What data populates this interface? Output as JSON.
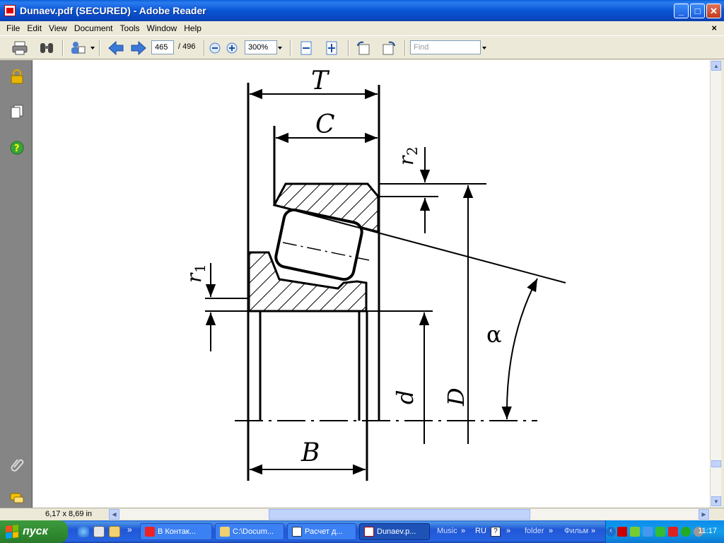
{
  "window": {
    "title": "Dunaev.pdf (SECURED) - Adobe Reader",
    "minimize_label": "_",
    "maximize_label": "□",
    "close_label": "✕"
  },
  "menu": {
    "items": [
      "File",
      "Edit",
      "View",
      "Document",
      "Tools",
      "Window",
      "Help"
    ],
    "doc_close": "×"
  },
  "toolbar": {
    "current_page": "465",
    "total_pages": "/ 496",
    "zoom": "300%",
    "find_placeholder": "Find"
  },
  "drawing": {
    "label_T": "T",
    "label_C": "C",
    "label_B": "B",
    "label_r1": "r",
    "label_r1_sub": "1",
    "label_r2": "r",
    "label_r2_sub": "2",
    "label_d": "d",
    "label_D": "D",
    "label_alpha": "α"
  },
  "status": {
    "page_size": "6,17 x 8,69 in"
  },
  "taskbar": {
    "start_label": "пуск",
    "chevron": "»",
    "tasks": [
      {
        "label": "В Контак..."
      },
      {
        "label": "C:\\Docum..."
      },
      {
        "label": "Расчет д..."
      },
      {
        "label": "Dunaev.p..."
      }
    ],
    "music": "Music",
    "lang": "RU",
    "folder": "folder",
    "film": "Фильм",
    "clock": "11:17"
  },
  "colors": {
    "titlebar": "#0a55d4",
    "taskbar": "#2157d7",
    "start": "#2f8a2f",
    "leftpanel": "#858585"
  }
}
